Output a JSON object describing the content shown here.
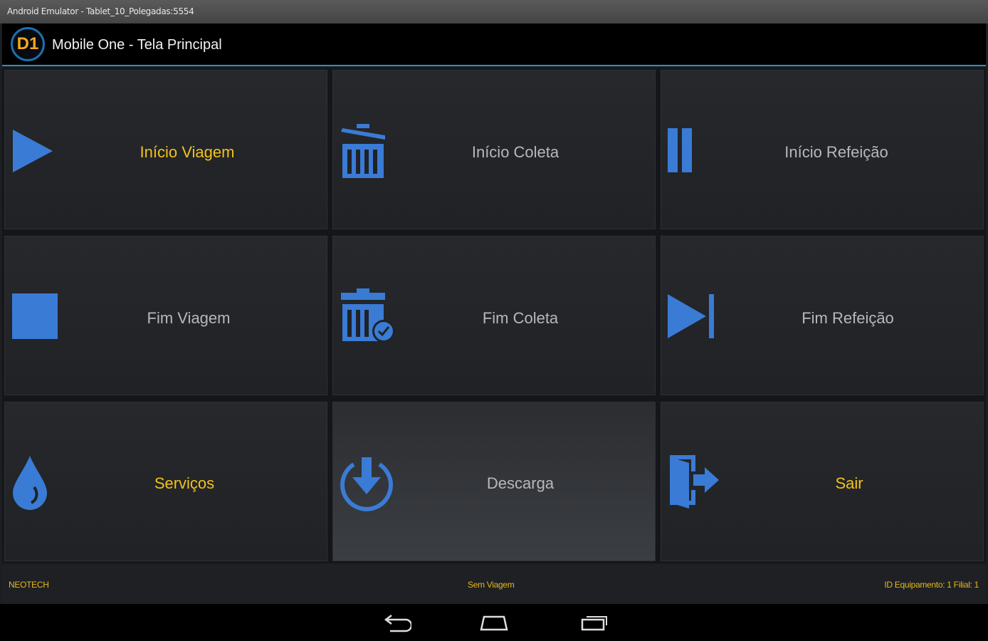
{
  "window": {
    "title": "Android Emulator - Tablet_10_Polegadas:5554"
  },
  "appbar": {
    "logo_text": "D1",
    "title": "Mobile One - Tela Principal"
  },
  "colors": {
    "accent_blue": "#3a7bd5",
    "label_yellow": "#f2c21a",
    "logo_orange": "#f4a81d"
  },
  "tiles": [
    {
      "label": "Início Viagem",
      "icon": "play-icon"
    },
    {
      "label": "Início Coleta",
      "icon": "trash-bin-icon"
    },
    {
      "label": "Início Refeição",
      "icon": "pause-icon"
    },
    {
      "label": "Fim Viagem",
      "icon": "stop-icon"
    },
    {
      "label": "Fim Coleta",
      "icon": "trash-bin-check-icon"
    },
    {
      "label": "Fim Refeição",
      "icon": "skip-next-icon"
    },
    {
      "label": "Serviços",
      "icon": "water-drop-icon"
    },
    {
      "label": "Descarga",
      "icon": "download-circle-icon"
    },
    {
      "label": "Sair",
      "icon": "exit-door-icon"
    }
  ],
  "status": {
    "company": "NEOTECH",
    "trip_status": "Sem Viagem",
    "device_info": "ID Equipamento: 1 Filial: 1"
  },
  "navbar": {
    "buttons": [
      "back-icon",
      "home-icon",
      "recent-apps-icon"
    ]
  }
}
